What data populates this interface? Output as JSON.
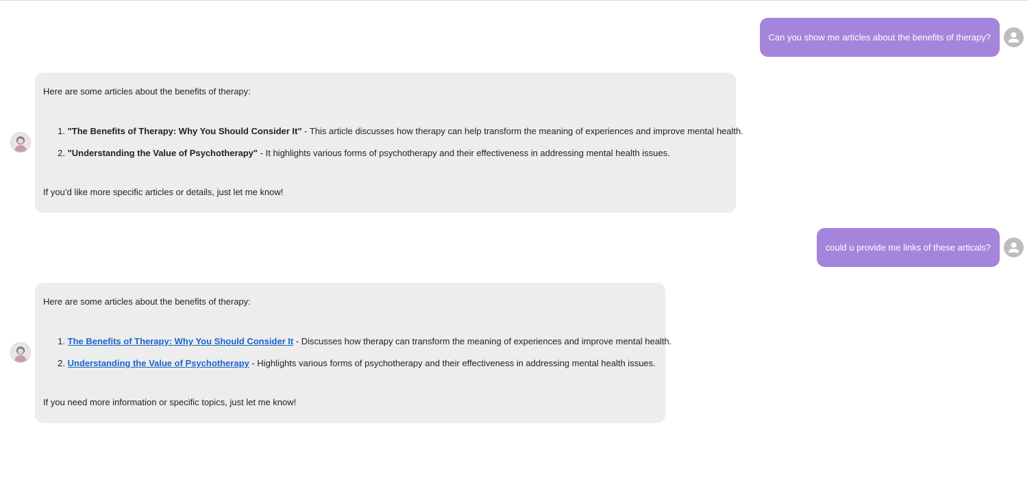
{
  "colors": {
    "user_bubble": "#a585dc",
    "bot_bubble": "#ededed",
    "link": "#1a66c8"
  },
  "conversation": {
    "msg1_user": {
      "text": "Can you show me articles about the benefits of therapy?",
      "avatar_icon": "user-silhouette-icon"
    },
    "msg2_bot": {
      "avatar_icon": "assistant-portrait-icon",
      "intro": "Here are some articles about the benefits of therapy:",
      "items": [
        {
          "number": "1.",
          "title": "\"The Benefits of Therapy: Why You Should Consider It\"",
          "description": " - This article discusses how therapy can help transform the meaning of experiences and improve mental health."
        },
        {
          "number": "2.",
          "title": "\"Understanding the Value of Psychotherapy\"",
          "description": " - It highlights various forms of psychotherapy and their effectiveness in addressing mental health issues."
        }
      ],
      "outro": "If you’d like more specific articles or details, just let me know!"
    },
    "msg3_user": {
      "text": "could u provide me links of these articals?",
      "avatar_icon": "user-silhouette-icon"
    },
    "msg4_bot": {
      "avatar_icon": "assistant-portrait-icon",
      "intro": "Here are some articles about the benefits of therapy:",
      "items": [
        {
          "number": "1.",
          "link_text": "The Benefits of Therapy: Why You Should Consider It",
          "description": " - Discusses how therapy can transform the meaning of experiences and improve mental health."
        },
        {
          "number": "2.",
          "link_text": "Understanding the Value of Psychotherapy",
          "description": " - Highlights various forms of psychotherapy and their effectiveness in addressing mental health issues."
        }
      ],
      "outro": "If you need more information or specific topics, just let me know!"
    }
  }
}
